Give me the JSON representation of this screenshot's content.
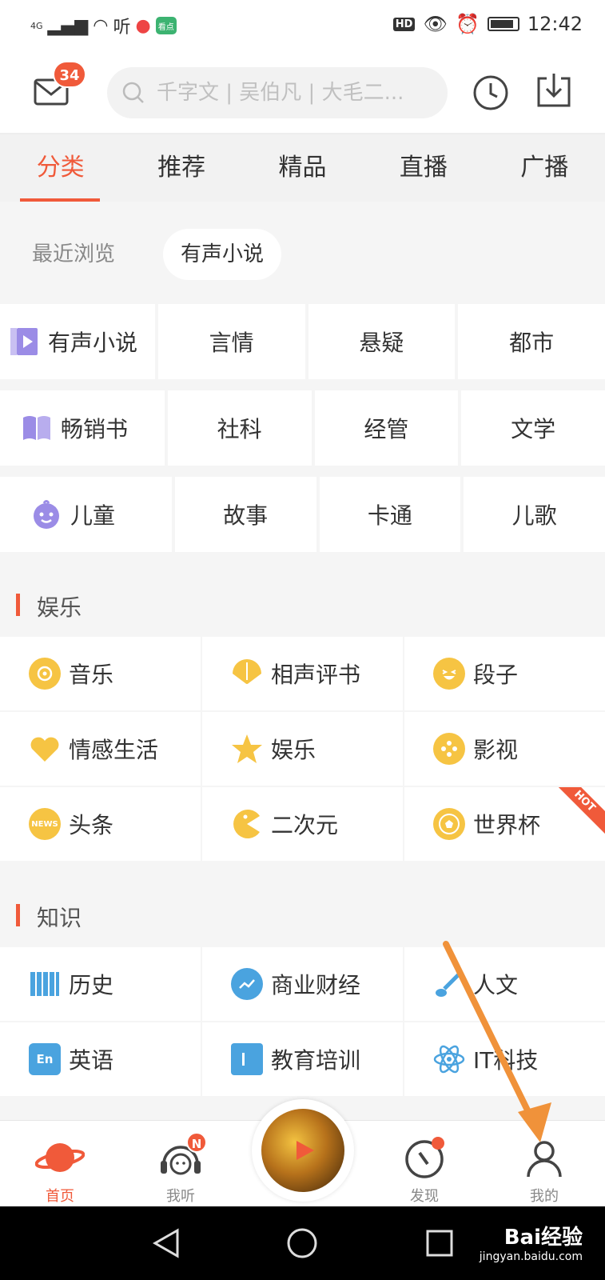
{
  "status_bar": {
    "network": "4G",
    "ting_label": "听",
    "app_badge": "看点",
    "hd": "HD",
    "time": "12:42"
  },
  "header": {
    "mail_count": "34",
    "search_placeholder": "千字文 | 吴伯凡 | 大毛二..."
  },
  "tabs": [
    "分类",
    "推荐",
    "精品",
    "直播",
    "广播"
  ],
  "subtabs": {
    "recent": "最近浏览",
    "active": "有声小说"
  },
  "categories": {
    "row1": [
      "有声小说",
      "言情",
      "悬疑",
      "都市"
    ],
    "row2": [
      "畅销书",
      "社科",
      "经管",
      "文学"
    ],
    "row3": [
      "儿童",
      "故事",
      "卡通",
      "儿歌"
    ]
  },
  "sections": {
    "ent_title": "娱乐",
    "know_title": "知识"
  },
  "entertainment": [
    [
      "音乐",
      "相声评书",
      "段子"
    ],
    [
      "情感生活",
      "娱乐",
      "影视"
    ],
    [
      "头条",
      "二次元",
      "世界杯"
    ]
  ],
  "hot_label": "HOT",
  "knowledge": [
    [
      "历史",
      "商业财经",
      "人文"
    ],
    [
      "英语",
      "教育培训",
      "IT科技"
    ]
  ],
  "bottom_nav": {
    "home": "首页",
    "listen": "我听",
    "listen_badge": "N",
    "discover": "发现",
    "mine": "我的"
  },
  "watermark": {
    "main": "Bai经验",
    "sub": "jingyan.baidu.com"
  },
  "colors": {
    "accent": "#f05a3a",
    "icon_yellow": "#f6c443",
    "icon_blue": "#4aa3df",
    "icon_purple": "#9b8ce6"
  }
}
